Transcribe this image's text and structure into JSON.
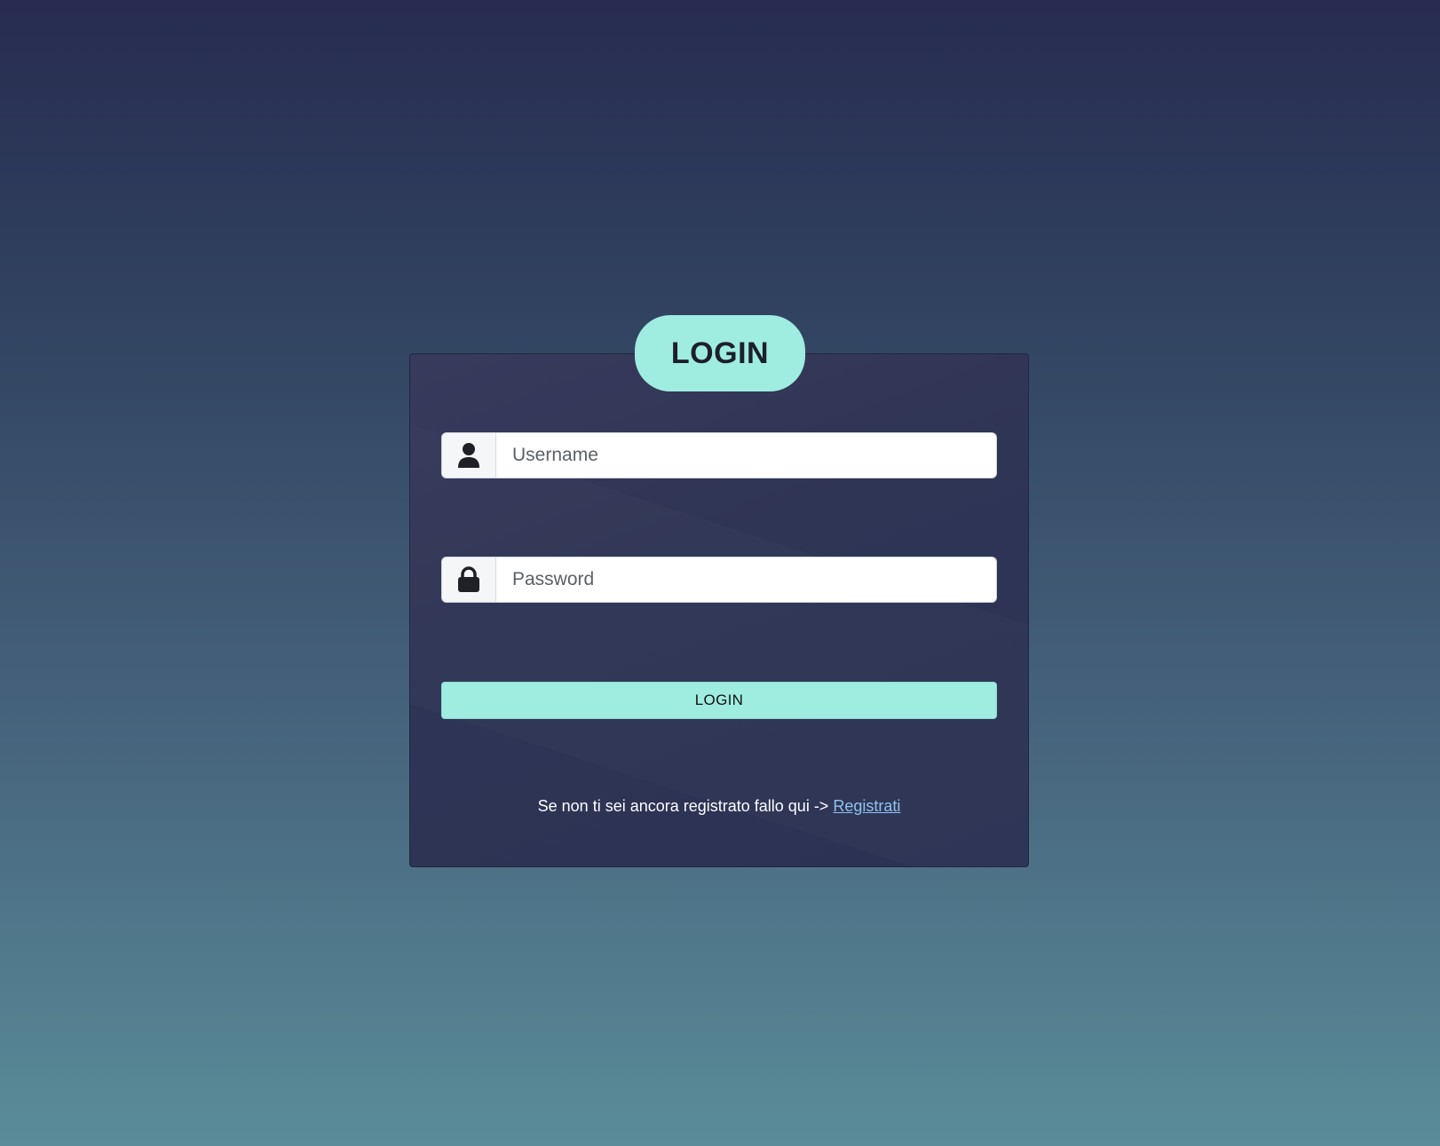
{
  "header": {
    "title": "LOGIN"
  },
  "form": {
    "username": {
      "placeholder": "Username",
      "value": "",
      "icon": "user-icon"
    },
    "password": {
      "placeholder": "Password",
      "value": "",
      "icon": "lock-icon"
    },
    "submit_label": "LOGIN"
  },
  "footer": {
    "register_text": "Se non ti sei ancora registrato fallo qui ->",
    "register_link": "Registrati"
  },
  "colors": {
    "accent": "#9fece1",
    "card_bg": "#2f3555",
    "link": "#8ec3f0",
    "bg_top": "#272c50",
    "bg_bottom": "#5a8c99"
  }
}
